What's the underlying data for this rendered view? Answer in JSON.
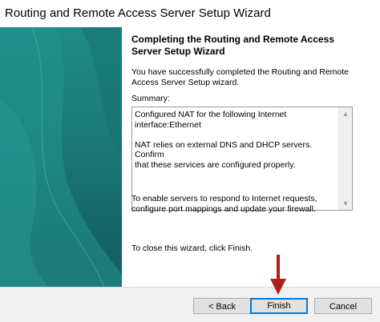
{
  "window": {
    "title": "Routing and Remote Access Server Setup Wizard"
  },
  "page": {
    "heading_line1": "Completing the Routing and Remote Access",
    "heading_line2": "Server Setup Wizard",
    "intro_line1": "You have successfully completed the Routing and Remote",
    "intro_line2": "Access Server Setup wizard.",
    "summary_label": "Summary:",
    "summary_text": "Configured NAT for the following Internet\ninterface:Ethernet\n\nNAT relies on external DNS and DHCP servers. Confirm\nthat these services are configured properly.",
    "instructions_line1": "To enable servers to respond to Internet requests,",
    "instructions_line2": "configure port mappings and update your firewall.",
    "close_text": "To close this wizard, click Finish."
  },
  "buttons": {
    "back": "< Back",
    "finish": "Finish",
    "cancel": "Cancel"
  },
  "colors": {
    "side_panel": "#1b7c79",
    "arrow": "#b01d1d",
    "focus_border": "#0078d7"
  },
  "icons": {
    "scroll_up": "▲",
    "scroll_down": "▼"
  }
}
